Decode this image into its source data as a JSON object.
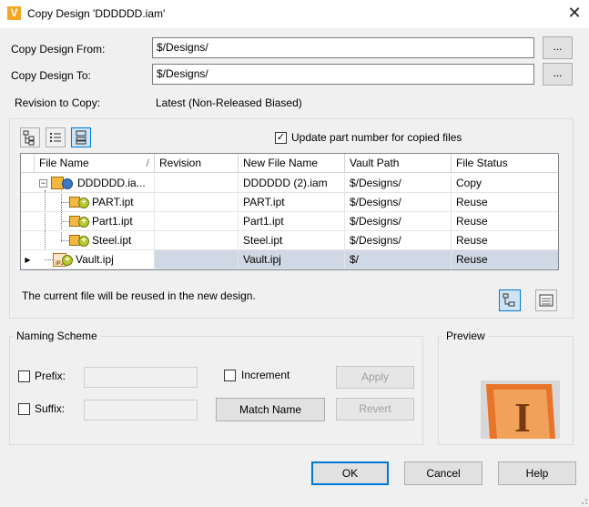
{
  "window": {
    "title": "Copy Design 'DDDDDD.iam'",
    "app_icon_glyph": "V",
    "close_glyph": "✕"
  },
  "form": {
    "from_label": "Copy Design From:",
    "from_value": "$/Designs/",
    "to_label": "Copy Design To:",
    "to_value": "$/Designs/",
    "browse_label": "...",
    "revision_label": "Revision to Copy:",
    "revision_value": "Latest (Non-Released Biased)"
  },
  "toolbar": {
    "update_part_label": "Update part number for copied files",
    "update_part_checked": true
  },
  "grid": {
    "columns": [
      "File Name",
      "Revision",
      "New File Name",
      "Vault Path",
      "File Status"
    ],
    "sort_glyph": "/",
    "rows": [
      {
        "name": "DDDDDD.ia...",
        "revision": "",
        "new_name": "DDDDDD (2).iam",
        "path": "$/Designs/",
        "status": "Copy"
      },
      {
        "name": "PART.ipt",
        "revision": "",
        "new_name": "PART.ipt",
        "path": "$/Designs/",
        "status": "Reuse"
      },
      {
        "name": "Part1.ipt",
        "revision": "",
        "new_name": "Part1.ipt",
        "path": "$/Designs/",
        "status": "Reuse"
      },
      {
        "name": "Steel.ipt",
        "revision": "",
        "new_name": "Steel.ipt",
        "path": "$/Designs/",
        "status": "Reuse"
      },
      {
        "name": "Vault.ipj",
        "revision": "",
        "new_name": "Vault.ipj",
        "path": "$/",
        "status": "Reuse"
      }
    ],
    "selected_row": 4,
    "row_pointer_glyph": "▶",
    "ipj_badge": "IPJ"
  },
  "status_message": "The current file will be reused in the new design.",
  "naming": {
    "group_label": "Naming Scheme",
    "prefix_label": "Prefix:",
    "prefix_value": "",
    "suffix_label": "Suffix:",
    "suffix_value": "",
    "increment_label": "Increment",
    "apply_label": "Apply",
    "match_name_label": "Match Name",
    "revert_label": "Revert"
  },
  "preview": {
    "group_label": "Preview",
    "logo_letter": "I"
  },
  "footer": {
    "ok_label": "OK",
    "cancel_label": "Cancel",
    "help_label": "Help"
  },
  "colors": {
    "accent": "#0078d7",
    "selected_row": "#cfd8e4",
    "inventor_orange": "#e8742a"
  }
}
